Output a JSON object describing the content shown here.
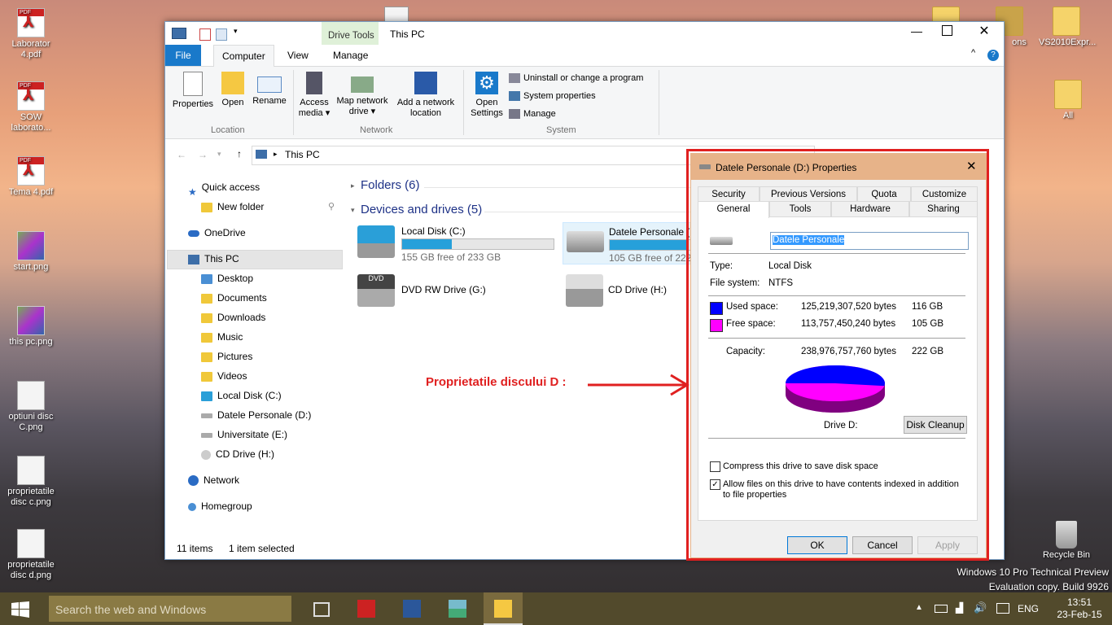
{
  "desktop": {
    "left_icons": [
      {
        "label": "Laborator 4.pdf",
        "icon": "pdf-icon"
      },
      {
        "label": "SOW laborato...",
        "icon": "pdf-icon"
      },
      {
        "label": "Tema 4.pdf",
        "icon": "pdf-icon"
      },
      {
        "label": "start.png",
        "icon": "image-icon"
      },
      {
        "label": "this pc.png",
        "icon": "image-icon"
      },
      {
        "label": "optiuni disc C.png",
        "icon": "image-icon"
      },
      {
        "label": "proprietatile disc c.png",
        "icon": "image-icon"
      },
      {
        "label": "proprietatile disc d.png",
        "icon": "image-icon"
      }
    ],
    "right_icons": [
      {
        "label": "",
        "icon": "folder-icon"
      },
      {
        "label": "ons",
        "icon": "folder-icon"
      },
      {
        "label": "VS2010Expr...",
        "icon": "folder-icon"
      },
      {
        "label": "All",
        "icon": "folder-icon"
      }
    ],
    "recycle_bin": "Recycle Bin",
    "watermark_line1": "Windows 10 Pro Technical Preview",
    "watermark_line2": "Evaluation copy. Build 9926",
    "annotation": "Proprietatile discului D :"
  },
  "explorer": {
    "title": "This PC",
    "contextual_tab": "Drive Tools",
    "tabs": {
      "file": "File",
      "computer": "Computer",
      "view": "View",
      "manage": "Manage"
    },
    "ribbon": {
      "properties": "Properties",
      "open": "Open",
      "rename": "Rename",
      "access_media": "Access media ▾",
      "map_network": "Map network drive ▾",
      "add_network": "Add a network location",
      "open_settings": "Open Settings",
      "uninstall": "Uninstall or change a program",
      "system_properties": "System properties",
      "manage": "Manage",
      "group_location": "Location",
      "group_network": "Network",
      "group_system": "System"
    },
    "address": "This PC",
    "nav": {
      "quick_access": "Quick access",
      "new_folder": "New folder",
      "onedrive": "OneDrive",
      "this_pc": "This PC",
      "desktop": "Desktop",
      "documents": "Documents",
      "downloads": "Downloads",
      "music": "Music",
      "pictures": "Pictures",
      "videos": "Videos",
      "local_disk_c": "Local Disk (C:)",
      "datele_personale_d": "Datele Personale (D:)",
      "universitate_e": "Universitate (E:)",
      "cd_drive_h": "CD Drive (H:)",
      "network": "Network",
      "homegroup": "Homegroup"
    },
    "folders_header": "Folders (6)",
    "devices_header": "Devices and drives (5)",
    "drives": [
      {
        "name": "Local Disk (C:)",
        "free": "155 GB free of 233 GB",
        "used_fraction": 0.33
      },
      {
        "name": "Datele Personale (D:)",
        "free": "105 GB free of 222 GB",
        "used_fraction": 0.52
      },
      {
        "name": "DVD RW Drive (G:)",
        "free": ""
      },
      {
        "name": "CD Drive (H:)",
        "free": ""
      }
    ],
    "status": {
      "items": "11 items",
      "selected": "1 item selected"
    }
  },
  "dialog": {
    "title": "Datele Personale (D:) Properties",
    "tabs_row1": [
      "Security",
      "Previous Versions",
      "Quota",
      "Customize"
    ],
    "tabs_row2": [
      "General",
      "Tools",
      "Hardware",
      "Sharing"
    ],
    "name_value": "Datele Personale",
    "type_label": "Type:",
    "type_value": "Local Disk",
    "fs_label": "File system:",
    "fs_value": "NTFS",
    "used_label": "Used space:",
    "used_bytes": "125,219,307,520 bytes",
    "used_gb": "116 GB",
    "free_label": "Free space:",
    "free_bytes": "113,757,450,240 bytes",
    "free_gb": "105 GB",
    "capacity_label": "Capacity:",
    "capacity_bytes": "238,976,757,760 bytes",
    "capacity_gb": "222 GB",
    "drive_label": "Drive D:",
    "disk_cleanup": "Disk Cleanup",
    "compress": "Compress this drive to save disk space",
    "index": "Allow files on this drive to have contents indexed in addition to file properties",
    "ok": "OK",
    "cancel": "Cancel",
    "apply": "Apply",
    "colors": {
      "used": "#0000ff",
      "free": "#ff00ff"
    }
  },
  "taskbar": {
    "search_placeholder": "Search the web and Windows",
    "lang": "ENG",
    "time": "13:51",
    "date": "23-Feb-15"
  }
}
